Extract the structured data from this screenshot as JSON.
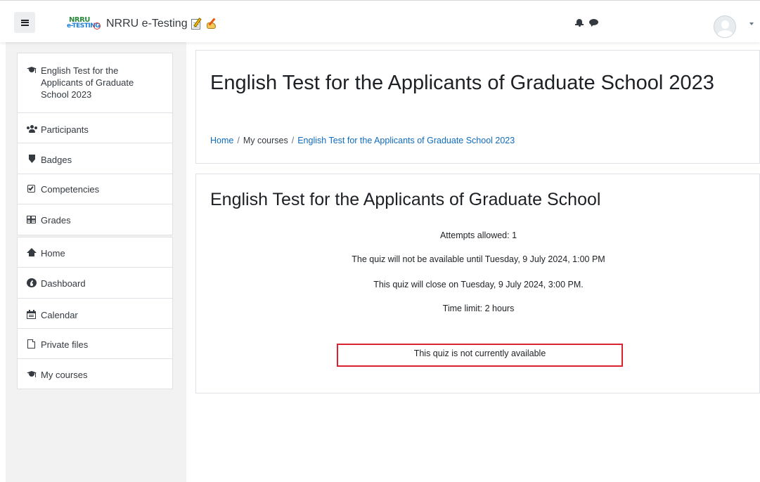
{
  "navbar": {
    "site_name": "NRRU e-Testing",
    "logo_top": "NRRU",
    "logo_bottom": "e-TESTING"
  },
  "drawer": {
    "course_items": [
      {
        "label": "English Test for the Applicants of Graduate School 2023",
        "icon": "graduation-cap-icon"
      },
      {
        "label": "Participants",
        "icon": "users-icon"
      },
      {
        "label": "Badges",
        "icon": "shield-icon"
      },
      {
        "label": "Competencies",
        "icon": "check-square-icon"
      },
      {
        "label": "Grades",
        "icon": "table-icon"
      }
    ],
    "site_items": [
      {
        "label": "Home",
        "icon": "home-icon"
      },
      {
        "label": "Dashboard",
        "icon": "dashboard-icon"
      },
      {
        "label": "Calendar",
        "icon": "calendar-icon"
      },
      {
        "label": "Private files",
        "icon": "file-icon"
      },
      {
        "label": "My courses",
        "icon": "graduation-cap-icon"
      }
    ]
  },
  "header": {
    "title": "English Test for the Applicants of Graduate School 2023",
    "breadcrumb": [
      "Home",
      "My courses",
      "English Test for the Applicants of Graduate School 2023"
    ]
  },
  "quiz": {
    "title": "English Test for the Applicants of Graduate School",
    "attempts": "Attempts allowed: 1",
    "open_notice": "The quiz will not be available until Tuesday, 9 July 2024, 1:00 PM",
    "close_notice": "This quiz will close on Tuesday, 9 July 2024, 3:00 PM.",
    "time_limit": "Time limit: 2 hours",
    "status": "This quiz is not currently available"
  },
  "colors": {
    "link": "#0f6cbf",
    "highlight_border": "#d9232e",
    "drawer_bg": "#f2f2f2"
  }
}
